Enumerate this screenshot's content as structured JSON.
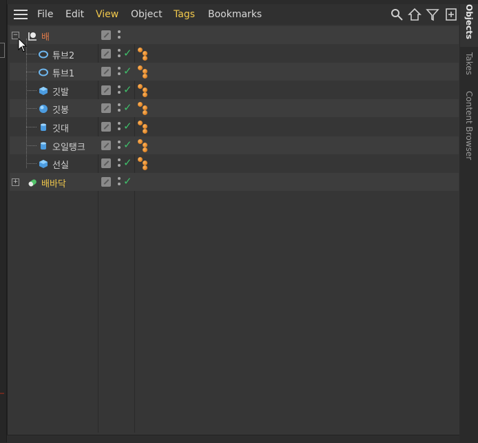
{
  "menu": {
    "items": [
      {
        "label": "File",
        "highlight": false
      },
      {
        "label": "Edit",
        "highlight": false
      },
      {
        "label": "View",
        "highlight": true
      },
      {
        "label": "Object",
        "highlight": false
      },
      {
        "label": "Tags",
        "highlight": true
      },
      {
        "label": "Bookmarks",
        "highlight": false
      }
    ]
  },
  "objects": [
    {
      "name": "배",
      "color": "#e07a4a",
      "icon": "null-object-icon",
      "expander": "−",
      "tags": false,
      "check": false
    },
    {
      "name": "튜브2",
      "color": "#cfcfcf",
      "icon": "tube-icon",
      "tags": true,
      "check": true
    },
    {
      "name": "튜브1",
      "color": "#cfcfcf",
      "icon": "tube-icon",
      "tags": true,
      "check": true
    },
    {
      "name": "깃발",
      "color": "#cfcfcf",
      "icon": "cube-icon",
      "tags": true,
      "check": true
    },
    {
      "name": "깃봉",
      "color": "#cfcfcf",
      "icon": "sphere-icon",
      "tags": true,
      "check": true
    },
    {
      "name": "깃대",
      "color": "#cfcfcf",
      "icon": "cylinder-icon",
      "tags": true,
      "check": true
    },
    {
      "name": "오일탱크",
      "color": "#cfcfcf",
      "icon": "cylinder-icon",
      "tags": true,
      "check": true
    },
    {
      "name": "선실",
      "color": "#cfcfcf",
      "icon": "cube-icon",
      "tags": true,
      "check": true
    },
    {
      "name": "배바닥",
      "color": "#f2c94c",
      "icon": "capsule-icon",
      "expander": "+",
      "tags": false,
      "check": true
    }
  ],
  "side_tabs": [
    {
      "label": "Objects",
      "active": true
    },
    {
      "label": "Takes",
      "active": false
    },
    {
      "label": "Content Browser",
      "active": false
    }
  ],
  "colors": {
    "accent_yellow": "#f2c94c",
    "accent_orange": "#e07a4a",
    "check_green": "#3fbf6a"
  }
}
